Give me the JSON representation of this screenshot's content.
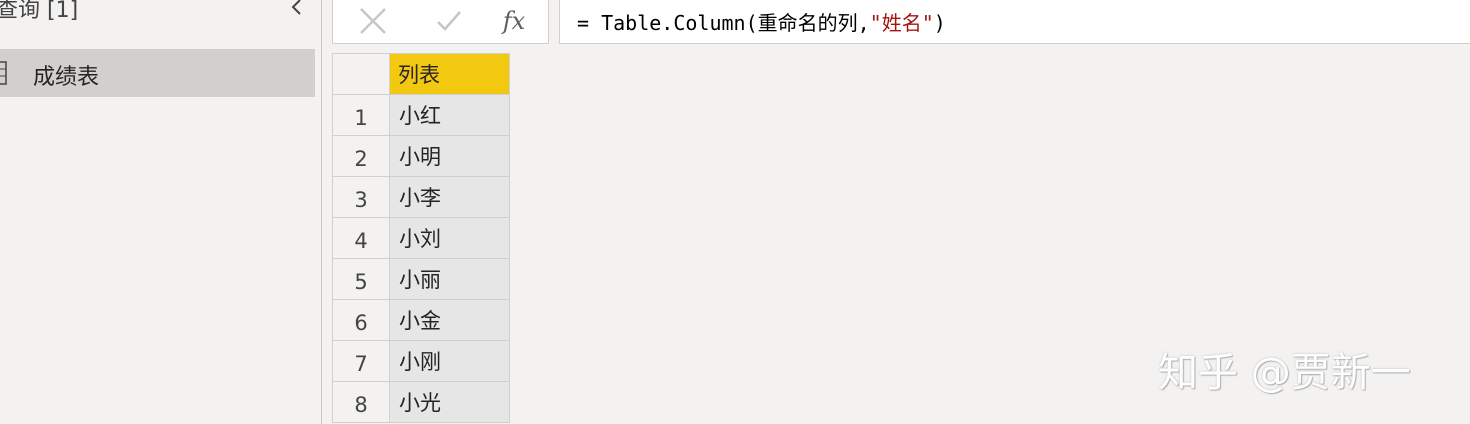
{
  "queries_pane": {
    "title": "查询 [1]",
    "collapse_icon": "chevron-left-icon",
    "items": [
      {
        "label": "成绩表",
        "icon": "table-icon",
        "selected": true
      }
    ]
  },
  "formula_bar": {
    "cancel_icon": "close-icon",
    "commit_icon": "checkmark-icon",
    "fx_label": "fx",
    "formula_prefix": "= Table.Column(重命名的列,",
    "formula_string": "\"姓名\"",
    "formula_suffix": ")"
  },
  "grid": {
    "column_header": "列表",
    "header_color": "#f2c811",
    "rows": [
      {
        "num": "1",
        "value": "小红"
      },
      {
        "num": "2",
        "value": "小明"
      },
      {
        "num": "3",
        "value": "小李"
      },
      {
        "num": "4",
        "value": "小刘"
      },
      {
        "num": "5",
        "value": "小丽"
      },
      {
        "num": "6",
        "value": "小金"
      },
      {
        "num": "7",
        "value": "小刚"
      },
      {
        "num": "8",
        "value": "小光"
      }
    ]
  },
  "watermark": "知乎 @贾新一"
}
